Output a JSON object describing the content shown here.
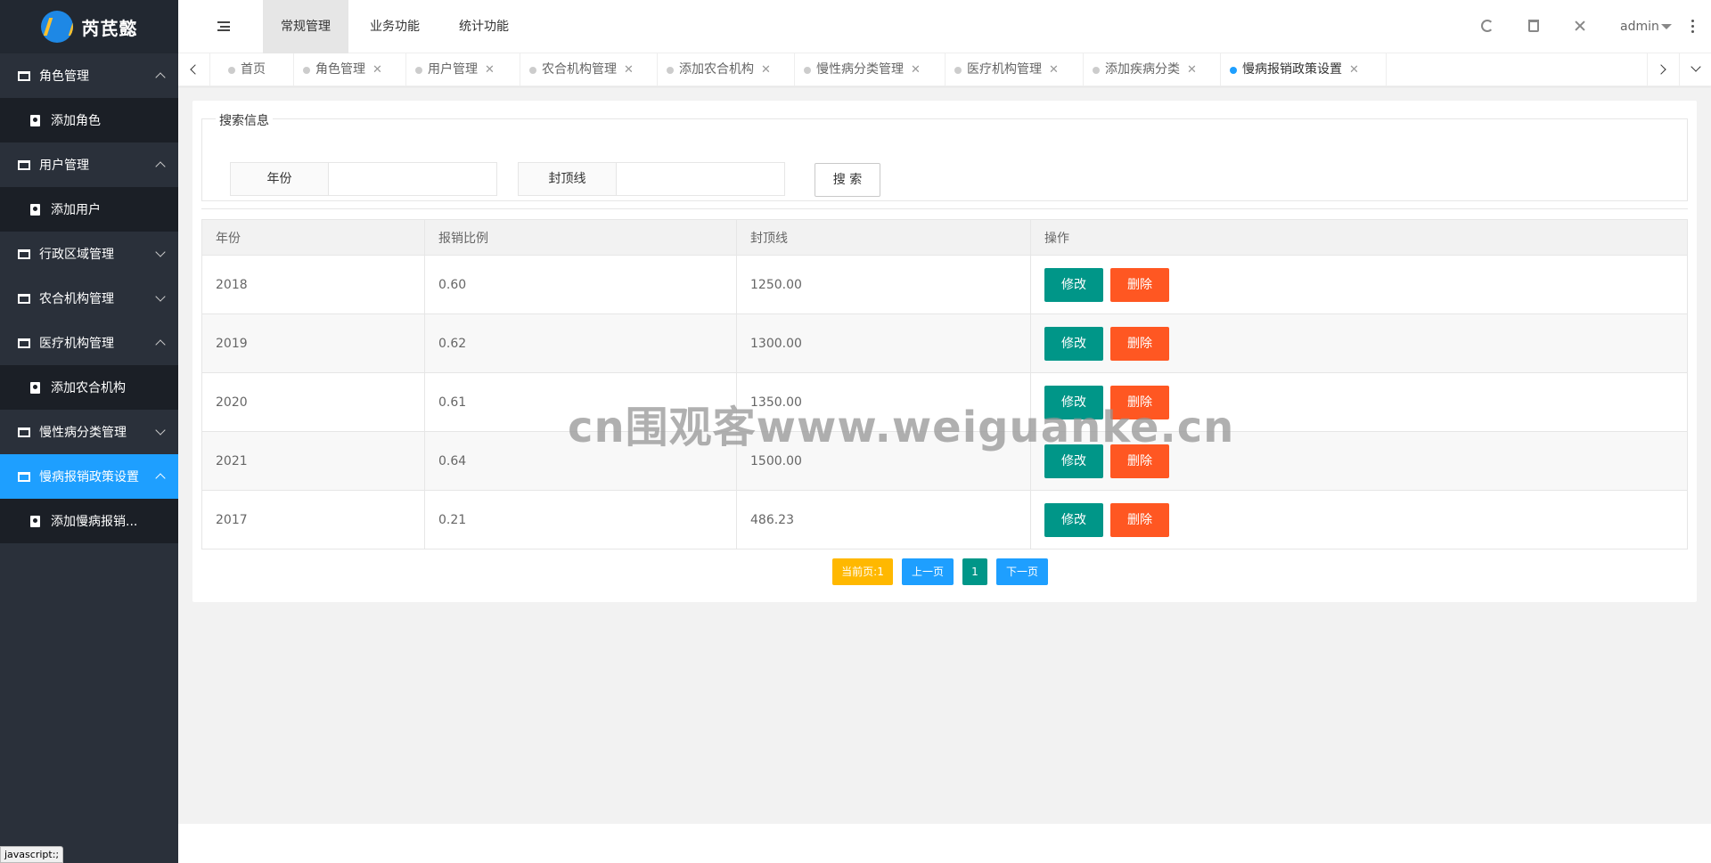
{
  "app": {
    "name": "芮芪懿"
  },
  "sidebar": {
    "items": [
      {
        "label": "角色管理",
        "sub": "添加角色"
      },
      {
        "label": "用户管理",
        "sub": "添加用户"
      },
      {
        "label": "行政区域管理"
      },
      {
        "label": "农合机构管理"
      },
      {
        "label": "医疗机构管理",
        "sub": "添加农合机构"
      },
      {
        "label": "慢性病分类管理"
      },
      {
        "label": "慢病报销政策设置",
        "sub": "添加慢病报销..."
      }
    ],
    "status_tip": "javascript:;"
  },
  "header": {
    "tabs": [
      "常规管理",
      "业务功能",
      "统计功能"
    ],
    "user": "admin"
  },
  "tabs": [
    {
      "label": "首页"
    },
    {
      "label": "角色管理"
    },
    {
      "label": "用户管理"
    },
    {
      "label": "农合机构管理"
    },
    {
      "label": "添加农合机构"
    },
    {
      "label": "慢性病分类管理"
    },
    {
      "label": "医疗机构管理"
    },
    {
      "label": "添加疾病分类"
    },
    {
      "label": "慢病报销政策设置"
    }
  ],
  "search": {
    "legend": "搜索信息",
    "year_label": "年份",
    "cap_label": "封顶线",
    "button": "搜 索"
  },
  "table": {
    "headers": [
      "年份",
      "报销比例",
      "封顶线",
      "操作"
    ],
    "rows": [
      {
        "year": "2018",
        "ratio": "0.60",
        "cap": "1250.00"
      },
      {
        "year": "2019",
        "ratio": "0.62",
        "cap": "1300.00"
      },
      {
        "year": "2020",
        "ratio": "0.61",
        "cap": "1350.00"
      },
      {
        "year": "2021",
        "ratio": "0.64",
        "cap": "1500.00"
      },
      {
        "year": "2017",
        "ratio": "0.21",
        "cap": "486.23"
      }
    ],
    "edit_label": "修改",
    "delete_label": "删除"
  },
  "pager": {
    "current": "当前页:1",
    "prev": "上一页",
    "page": "1",
    "next": "下一页"
  },
  "watermark": "cn围观客www.weiguanke.cn",
  "colors": {
    "accent": "#1e9fff",
    "edit": "#009688",
    "delete": "#ff5722",
    "current": "#ffb800",
    "sidebar": "#2a303a"
  }
}
